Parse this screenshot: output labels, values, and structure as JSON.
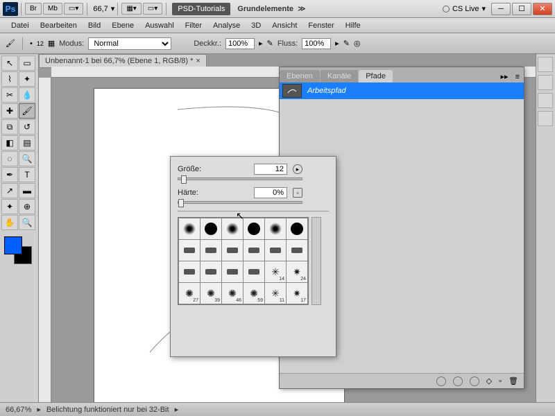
{
  "titlebar": {
    "br": "Br",
    "mb": "Mb",
    "zoom": "66,7",
    "psd_tut": "PSD-Tutorials",
    "grund": "Grundelemente",
    "cslive": "CS Live"
  },
  "menu": [
    "Datei",
    "Bearbeiten",
    "Bild",
    "Ebene",
    "Auswahl",
    "Filter",
    "Analyse",
    "3D",
    "Ansicht",
    "Fenster",
    "Hilfe"
  ],
  "optbar": {
    "brush_size": "12",
    "modus_label": "Modus:",
    "modus_value": "Normal",
    "deck_label": "Deckkr.:",
    "deck_value": "100%",
    "fluss_label": "Fluss:",
    "fluss_value": "100%"
  },
  "doc_tab": "Unbenannt-1 bei 66,7% (Ebene 1, RGB/8) *",
  "paths_panel": {
    "tabs": [
      "Ebenen",
      "Kanäle",
      "Pfade"
    ],
    "active_tab": 2,
    "row_label": "Arbeitspfad"
  },
  "brush_popup": {
    "size_label": "Größe:",
    "size_value": "12",
    "hard_label": "Härte:",
    "hard_value": "0%",
    "preset_labels": [
      "",
      "",
      "",
      "",
      "",
      "",
      "",
      "",
      "",
      "",
      "",
      "",
      "",
      "",
      "",
      "",
      "14",
      "24",
      "27",
      "39",
      "46",
      "59",
      "11",
      "17"
    ]
  },
  "status": {
    "zoom": "66,67%",
    "msg": "Belichtung funktioniert nur bei 32-Bit"
  }
}
